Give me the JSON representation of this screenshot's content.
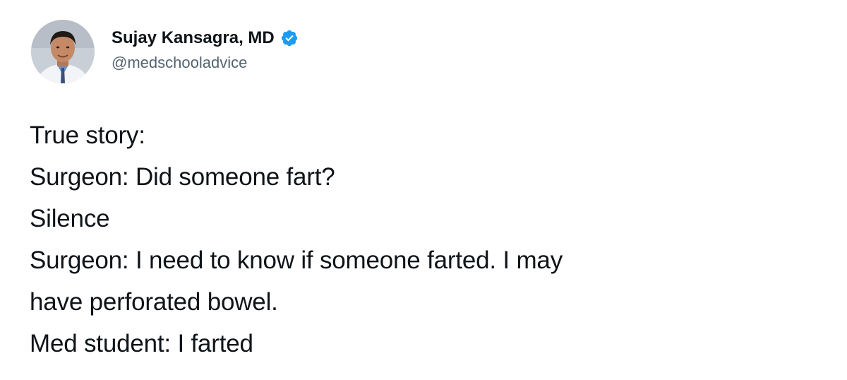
{
  "author": {
    "display_name": "Sujay Kansagra, MD",
    "handle": "@medschooladvice",
    "verified": true,
    "avatar_icon": "profile-photo",
    "verified_icon": "verified-badge-icon"
  },
  "tweet": {
    "lines": [
      "True story:",
      "Surgeon: Did someone fart?",
      "Silence",
      "Surgeon: I need to know if someone farted. I may",
      "have perforated bowel.",
      "Med student: I farted"
    ]
  },
  "colors": {
    "text": "#0f1419",
    "handle": "#536471",
    "verified_badge": "#1d9bf0"
  }
}
